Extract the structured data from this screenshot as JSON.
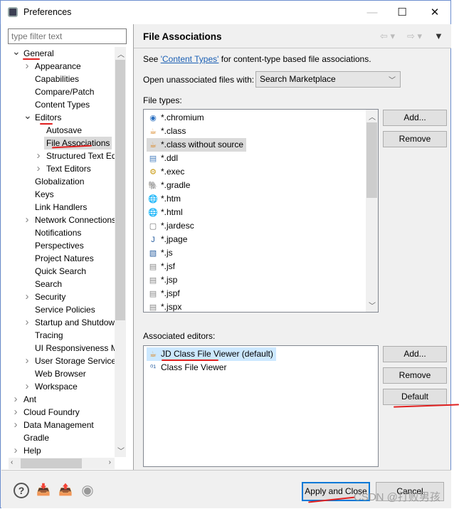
{
  "window": {
    "title": "Preferences",
    "minimize": "—",
    "maximize": "☐",
    "close": "✕"
  },
  "filter": {
    "placeholder": "type filter text"
  },
  "tree": [
    {
      "label": "General",
      "level": 0,
      "expander": "expanded"
    },
    {
      "label": "Appearance",
      "level": 1,
      "expander": "collapsed"
    },
    {
      "label": "Capabilities",
      "level": 1
    },
    {
      "label": "Compare/Patch",
      "level": 1
    },
    {
      "label": "Content Types",
      "level": 1
    },
    {
      "label": "Editors",
      "level": 1,
      "expander": "expanded"
    },
    {
      "label": "Autosave",
      "level": 2
    },
    {
      "label": "File Associations",
      "level": 2,
      "selected": true
    },
    {
      "label": "Structured Text Ed",
      "level": 2,
      "expander": "collapsed"
    },
    {
      "label": "Text Editors",
      "level": 2,
      "expander": "collapsed"
    },
    {
      "label": "Globalization",
      "level": 1
    },
    {
      "label": "Keys",
      "level": 1
    },
    {
      "label": "Link Handlers",
      "level": 1
    },
    {
      "label": "Network Connections",
      "level": 1,
      "expander": "collapsed"
    },
    {
      "label": "Notifications",
      "level": 1
    },
    {
      "label": "Perspectives",
      "level": 1
    },
    {
      "label": "Project Natures",
      "level": 1
    },
    {
      "label": "Quick Search",
      "level": 1
    },
    {
      "label": "Search",
      "level": 1
    },
    {
      "label": "Security",
      "level": 1,
      "expander": "collapsed"
    },
    {
      "label": "Service Policies",
      "level": 1
    },
    {
      "label": "Startup and Shutdown",
      "level": 1,
      "expander": "collapsed"
    },
    {
      "label": "Tracing",
      "level": 1
    },
    {
      "label": "UI Responsiveness Monitoring",
      "level": 1
    },
    {
      "label": "User Storage Service",
      "level": 1,
      "expander": "collapsed"
    },
    {
      "label": "Web Browser",
      "level": 1
    },
    {
      "label": "Workspace",
      "level": 1,
      "expander": "collapsed"
    },
    {
      "label": "Ant",
      "level": 0,
      "expander": "collapsed"
    },
    {
      "label": "Cloud Foundry",
      "level": 0,
      "expander": "collapsed"
    },
    {
      "label": "Data Management",
      "level": 0,
      "expander": "collapsed"
    },
    {
      "label": "Gradle",
      "level": 0
    },
    {
      "label": "Help",
      "level": 0,
      "expander": "collapsed"
    }
  ],
  "page": {
    "title": "File Associations",
    "see_prefix": "See ",
    "see_link": "'Content Types'",
    "see_suffix": " for content-type based file associations.",
    "open_label": "Open unassociated files with:",
    "open_value": "Search Marketplace",
    "file_types_label": "File types:",
    "associated_label": "Associated editors:"
  },
  "file_types": [
    {
      "name": "*.chromium",
      "icon": "chromium-icon",
      "glyph": "◉",
      "color": "#2a6fc0"
    },
    {
      "name": "*.class",
      "icon": "java-class-icon",
      "glyph": "☕",
      "color": "#d98a2b"
    },
    {
      "name": "*.class without source",
      "icon": "java-class-icon",
      "glyph": "☕",
      "color": "#d98a2b",
      "selected": true
    },
    {
      "name": "*.ddl",
      "icon": "ddl-file-icon",
      "glyph": "▤",
      "color": "#4a7fbf"
    },
    {
      "name": "*.exec",
      "icon": "gears-icon",
      "glyph": "⚙",
      "color": "#c99a10"
    },
    {
      "name": "*.gradle",
      "icon": "gradle-elephant-icon",
      "glyph": "🐘",
      "color": "#1f4a5a"
    },
    {
      "name": "*.htm",
      "icon": "globe-icon",
      "glyph": "🌐",
      "color": "#3a7ab0"
    },
    {
      "name": "*.html",
      "icon": "globe-icon",
      "glyph": "🌐",
      "color": "#3a7ab0"
    },
    {
      "name": "*.jardesc",
      "icon": "jar-icon",
      "glyph": "▢",
      "color": "#777"
    },
    {
      "name": "*.jpage",
      "icon": "java-page-icon",
      "glyph": "J",
      "color": "#2a5fa0"
    },
    {
      "name": "*.js",
      "icon": "js-file-icon",
      "glyph": "▧",
      "color": "#2a5fa0"
    },
    {
      "name": "*.jsf",
      "icon": "text-file-icon",
      "glyph": "▤",
      "color": "#888"
    },
    {
      "name": "*.jsp",
      "icon": "text-file-icon",
      "glyph": "▤",
      "color": "#888"
    },
    {
      "name": "*.jspf",
      "icon": "text-file-icon",
      "glyph": "▤",
      "color": "#888"
    },
    {
      "name": "*.jspx",
      "icon": "text-file-icon",
      "glyph": "▤",
      "color": "#888"
    }
  ],
  "editors": [
    {
      "name": "JD Class File Viewer (default)",
      "icon": "java-class-icon",
      "glyph": "☕",
      "color": "#d98a2b",
      "selected": true
    },
    {
      "name": "Class File Viewer",
      "icon": "binary-class-icon",
      "glyph": "⁰¹",
      "color": "#2a5fa0"
    }
  ],
  "buttons": {
    "add": "Add...",
    "remove": "Remove",
    "default": "Default",
    "apply_close": "Apply and Close",
    "cancel": "Cancel"
  },
  "watermark": "CSDN @打败男孩",
  "colors": {
    "selection": "#dadada",
    "editor_selection": "#cce8ff",
    "focus_border": "#0078d7",
    "annotation": "#e02020",
    "link": "#1a5fb4"
  }
}
